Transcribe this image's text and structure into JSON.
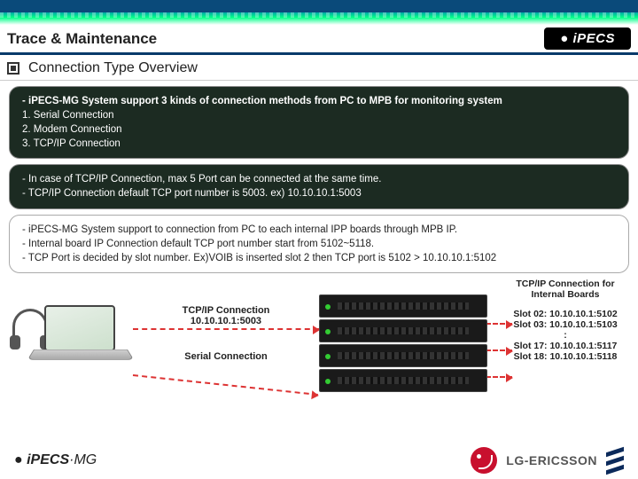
{
  "header": {
    "title": "Trace & Maintenance",
    "logo": "iPECS"
  },
  "subtitle": "Connection Type Overview",
  "box1": {
    "lead": "- iPECS-MG System support 3 kinds of connection methods from PC to MPB for monitoring system",
    "l1": "1. Serial Connection",
    "l2": "2. Modem Connection",
    "l3": "3. TCP/IP Connection"
  },
  "box2": {
    "l1": "- In case of TCP/IP Connection, max 5 Port can be connected at the same time.",
    "l2": "- TCP/IP Connection default TCP port number is 5003. ex) 10.10.10.1:5003"
  },
  "box3": {
    "l1": "- iPECS-MG System support to connection from PC to each internal IPP boards through MPB IP.",
    "l2": "- Internal board IP Connection default TCP port number start from 5102~5118.",
    "l3": "-  TCP Port is decided by slot number.  Ex)VOIB is inserted slot 2 then TCP port is 5102 > 10.10.10.1:5102"
  },
  "diagram": {
    "tcp_label": "TCP/IP Connection",
    "tcp_addr": "10.10.10.1:5003",
    "serial_label": "Serial Connection",
    "side_head": "TCP/IP Connection for Internal Boards",
    "s1": "Slot 02: 10.10.10.1:5102",
    "s2": "Slot 03: 10.10.10.1:5103",
    "sdots": ":",
    "s3": "Slot 17: 10.10.10.1:5117",
    "s4": "Slot 18: 10.10.10.1:5118"
  },
  "footer": {
    "logo_left": "iPECS",
    "logo_left_suffix": "·MG",
    "lg_text": "LG-ERICSSON"
  }
}
